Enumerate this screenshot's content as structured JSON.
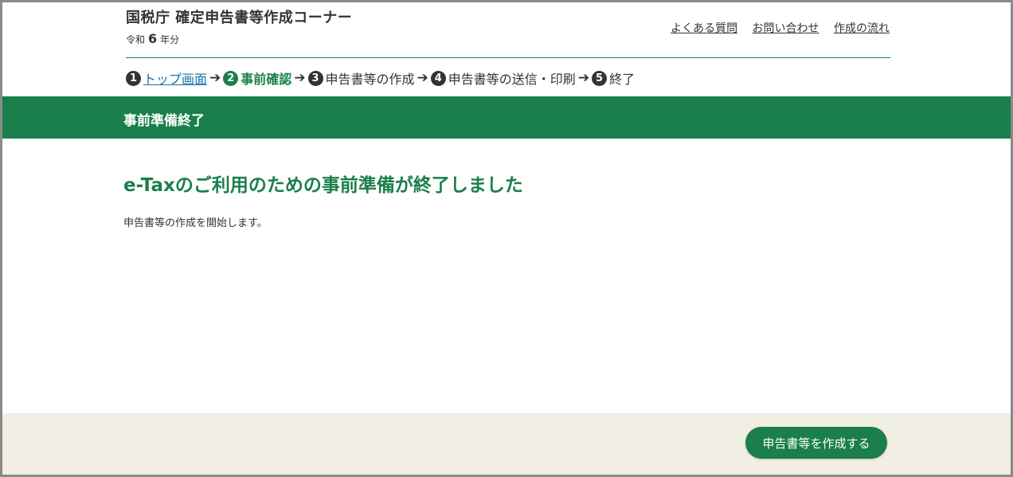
{
  "header": {
    "site_title": "国税庁 確定申告書等作成コーナー",
    "era": "令和",
    "year": "6",
    "year_suffix": "年分",
    "links": [
      "よくある質問",
      "お問い合わせ",
      "作成の流れ"
    ]
  },
  "steps": [
    {
      "num": "1",
      "label": "トップ画面",
      "state": "link"
    },
    {
      "num": "2",
      "label": "事前確認",
      "state": "current"
    },
    {
      "num": "3",
      "label": "申告書等の作成",
      "state": "normal"
    },
    {
      "num": "4",
      "label": "申告書等の送信・印刷",
      "state": "normal"
    },
    {
      "num": "5",
      "label": "終了",
      "state": "normal"
    }
  ],
  "step_arrow": "➔",
  "banner": {
    "title": "事前準備終了"
  },
  "main": {
    "heading": "e-Taxのご利用のための事前準備が終了しました",
    "text": "申告書等の作成を開始します。"
  },
  "footer": {
    "button_label": "申告書等を作成する"
  },
  "colors": {
    "brand_green": "#1a7f4b",
    "footer_bg": "#f1eee3",
    "link_blue": "#1a6fa8"
  }
}
